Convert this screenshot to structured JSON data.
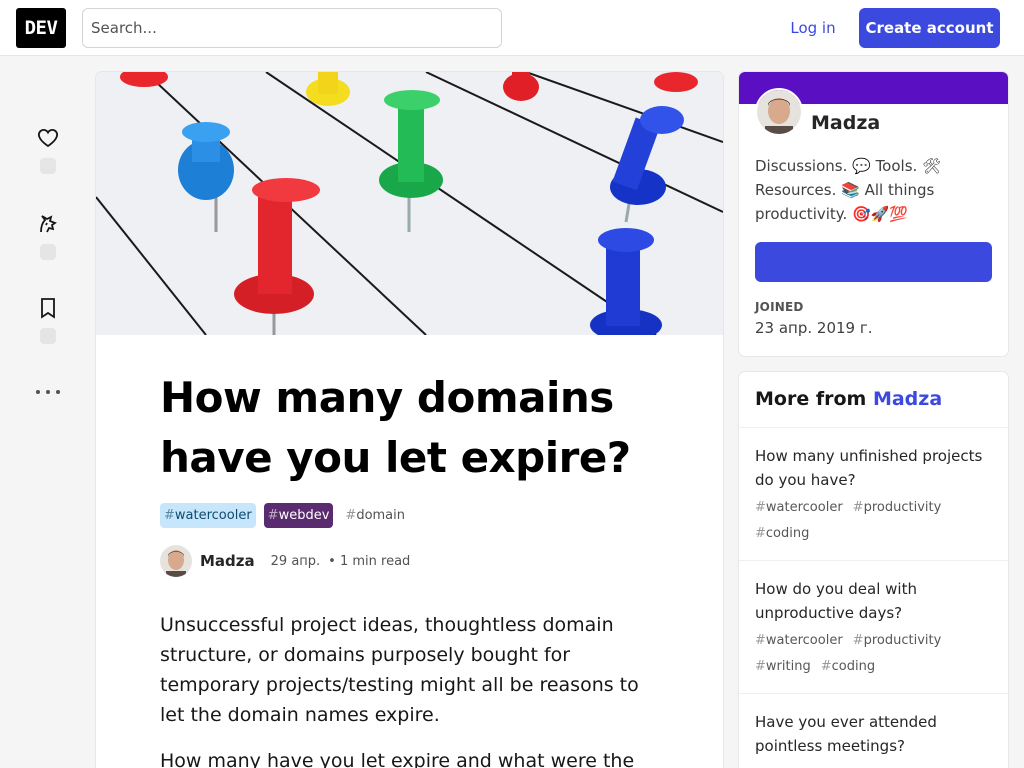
{
  "header": {
    "logo": "DEV",
    "search_placeholder": "Search...",
    "login_label": "Log in",
    "create_label": "Create account"
  },
  "article": {
    "title": "How many domains have you let expire?",
    "tags": [
      {
        "hash": "#",
        "name": "watercooler"
      },
      {
        "hash": "#",
        "name": "webdev"
      },
      {
        "hash": "#",
        "name": "domain"
      }
    ],
    "author": "Madza",
    "date": "29 апр.",
    "read_time": "• 1 min read",
    "paragraphs": [
      "Unsuccessful project ideas, thoughtless domain structure, or domains purposely bought for temporary projects/testing might all be reasons to let the domain names expire.",
      "How many have you let expire and what were the"
    ]
  },
  "profile": {
    "band_color": "#5b0fc2",
    "name": "Madza",
    "bio": "Discussions. 💬 Tools. 🛠 Resources. 📚 All things productivity. 🎯🚀💯",
    "joined_label": "JOINED",
    "joined_date": "23 апр. 2019 г."
  },
  "more_from": {
    "prefix": "More from ",
    "name": "Madza",
    "items": [
      {
        "title": "How many unfinished projects do you have?",
        "tags": [
          "watercooler",
          "productivity",
          "coding"
        ]
      },
      {
        "title": "How do you deal with unproductive days?",
        "tags": [
          "watercooler",
          "productivity",
          "writing",
          "coding"
        ]
      },
      {
        "title": "Have you ever attended pointless meetings?",
        "tags": []
      }
    ]
  },
  "colors": {
    "accent": "#3b49df",
    "background": "#f5f5f5"
  }
}
